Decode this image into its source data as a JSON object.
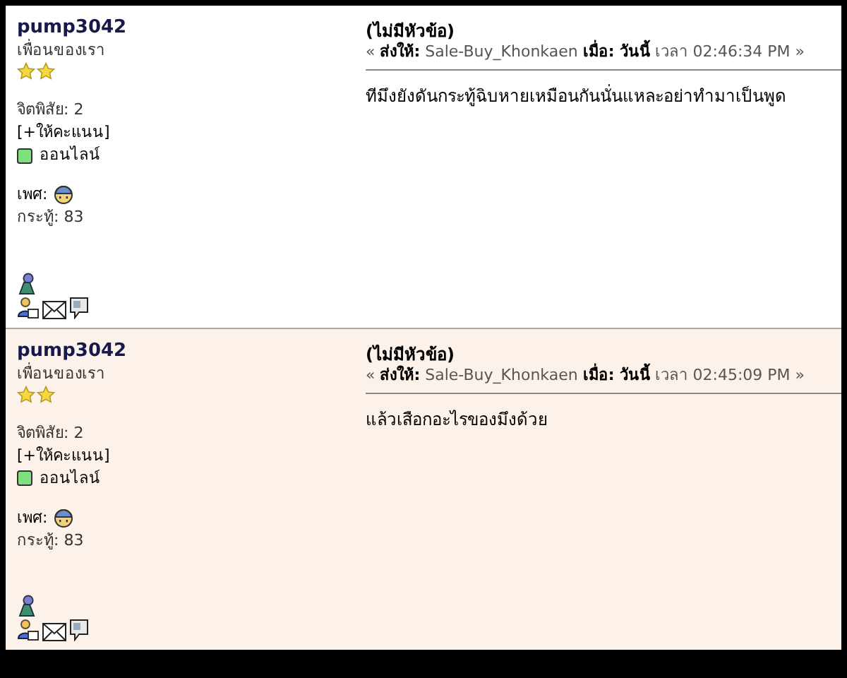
{
  "posts": [
    {
      "author": {
        "name": "pump3042",
        "group": "เพื่อนของเรา",
        "rank_stars": [
          {
            "filled": true
          },
          {
            "filled": true
          }
        ],
        "karma": "จิตพิสัย: 2",
        "karma_link": "[+ให้คะแนน]",
        "online": true,
        "status": "ออนไลน์",
        "gender_label": "เพศ:",
        "posts_count": "กระทู้: 83"
      },
      "subject": "(ไม่มีหัวข้อ)",
      "meta": "« **ส่งให้:** Sale-Buy_Khonkaen **เมื่อ:** **วันนี้** เวลา 02:46:34 PM »",
      "body": "ทีมึงยังดันกระทู้ฉิบหายเหมือนกันนั่นแหละอย่าทำมาเป็นพูด"
    },
    {
      "author": {
        "name": "pump3042",
        "group": "เพื่อนของเรา",
        "rank_stars": [
          {
            "filled": true
          },
          {
            "filled": true
          }
        ],
        "karma": "จิตพิสัย: 2",
        "karma_link": "[+ให้คะแนน]",
        "online": true,
        "status": "ออนไลน์",
        "gender_label": "เพศ:",
        "posts_count": "กระทู้: 83"
      },
      "subject": "(ไม่มีหัวข้อ)",
      "meta": "« **ส่งให้:** Sale-Buy_Khonkaen **เมื่อ:** **วันนี้** เวลา 02:45:09 PM »",
      "body": "แล้วเสือกอะไรของมึงด้วย"
    }
  ]
}
